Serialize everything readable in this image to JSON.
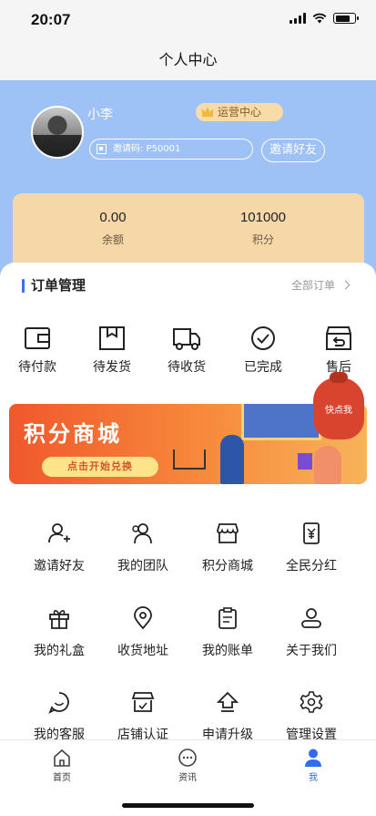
{
  "status_bar": {
    "time": "20:07"
  },
  "nav": {
    "title": "个人中心"
  },
  "profile": {
    "username": "小李",
    "role_badge": "运营中心",
    "invite_code": "邀请码: P50001",
    "invite_button": "邀请好友"
  },
  "wallet": {
    "balance_value": "0.00",
    "balance_label": "余额",
    "points_value": "101000",
    "points_label": "积分"
  },
  "orders": {
    "title": "订单管理",
    "all_link": "全部订单",
    "items": [
      {
        "label": "待付款",
        "icon": "wallet-icon"
      },
      {
        "label": "待发货",
        "icon": "package-icon"
      },
      {
        "label": "待收货",
        "icon": "truck-icon"
      },
      {
        "label": "已完成",
        "icon": "check-circle-icon"
      },
      {
        "label": "售后",
        "icon": "return-box-icon"
      }
    ]
  },
  "quick_tag": "快点我",
  "banner": {
    "title": "积分商城",
    "button": "点击开始兑换"
  },
  "grid": {
    "items": [
      {
        "label": "邀请好友",
        "icon": "add-user-icon"
      },
      {
        "label": "我的团队",
        "icon": "team-icon"
      },
      {
        "label": "积分商城",
        "icon": "store-icon"
      },
      {
        "label": "全民分红",
        "icon": "yen-card-icon"
      },
      {
        "label": "我的礼盒",
        "icon": "gift-icon"
      },
      {
        "label": "收货地址",
        "icon": "location-icon"
      },
      {
        "label": "我的账单",
        "icon": "bill-icon"
      },
      {
        "label": "关于我们",
        "icon": "about-icon"
      },
      {
        "label": "我的客服",
        "icon": "chat-icon"
      },
      {
        "label": "店铺认证",
        "icon": "shop-verify-icon"
      },
      {
        "label": "申请升级",
        "icon": "upgrade-icon"
      },
      {
        "label": "管理设置",
        "icon": "settings-icon"
      }
    ]
  },
  "tabbar": {
    "items": [
      {
        "label": "首页",
        "icon": "home-icon",
        "active": false
      },
      {
        "label": "资讯",
        "icon": "news-icon",
        "active": false
      },
      {
        "label": "我",
        "icon": "user-icon",
        "active": true
      }
    ]
  },
  "colors": {
    "header": "#9ec1f6",
    "wallet_card": "#f6d7a8",
    "accent": "#2f6cf0",
    "banner": "#f0582c"
  }
}
